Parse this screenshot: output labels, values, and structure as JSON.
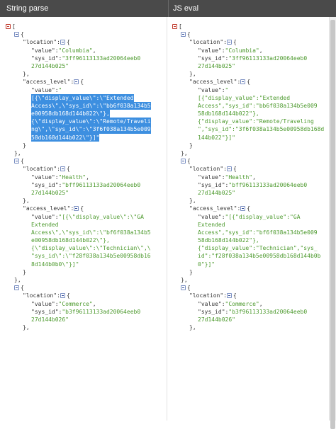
{
  "headers": {
    "left": "String parse",
    "right": "JS eval"
  },
  "left_lines": [
    {
      "i": 0,
      "t": "red",
      "parts": [
        [
          "p",
          "["
        ]
      ]
    },
    {
      "i": 2,
      "t": "blue",
      "parts": [
        [
          "p",
          "{"
        ]
      ]
    },
    {
      "i": 4,
      "parts": [
        [
          "k",
          "\"location\""
        ],
        [
          "p",
          ":"
        ]
      ],
      "t2": "blue",
      "after": [
        [
          "p",
          "{"
        ]
      ]
    },
    {
      "i": 6,
      "parts": [
        [
          "k",
          "\"value\""
        ],
        [
          "p",
          ":"
        ],
        [
          "s",
          "\"Columbia\""
        ],
        [
          "p",
          ","
        ]
      ]
    },
    {
      "i": 6,
      "parts": [
        [
          "k",
          "\"sys_id\""
        ],
        [
          "p",
          ":"
        ],
        [
          "s",
          "\"3ff96113133ad20064eeb0"
        ]
      ]
    },
    {
      "i": 6,
      "parts": [
        [
          "s",
          "27d144b025\""
        ]
      ]
    },
    {
      "i": 4,
      "parts": [
        [
          "p",
          "},"
        ]
      ]
    },
    {
      "i": 4,
      "parts": [
        [
          "k",
          "\"access_level\""
        ],
        [
          "p",
          ":"
        ]
      ],
      "t2": "blue",
      "after": [
        [
          "p",
          "{"
        ]
      ]
    },
    {
      "i": 6,
      "parts": [
        [
          "k",
          "\"value\""
        ],
        [
          "p",
          ":"
        ],
        [
          "s",
          "\""
        ]
      ]
    },
    {
      "i": 6,
      "sel": true,
      "parts": [
        [
          "x",
          "[{\\\"display_value\\\":\\\"Extended"
        ]
      ]
    },
    {
      "i": 6,
      "sel": true,
      "parts": [
        [
          "x",
          "Access\\\",\\\"sys_id\\\":\\\"bb6f038a134b5"
        ]
      ]
    },
    {
      "i": 6,
      "sel": true,
      "parts": [
        [
          "x",
          "e00958db168d144b022\\\"},"
        ]
      ]
    },
    {
      "i": 6,
      "sel": true,
      "parts": [
        [
          "x",
          "{\\\"display_value\\\":\\\"Remote/Traveli"
        ]
      ]
    },
    {
      "i": 6,
      "sel": true,
      "parts": [
        [
          "x",
          "ng\\\",\\\"sys_id\\\":\\\"3f6f038a134b5e009"
        ]
      ]
    },
    {
      "i": 6,
      "sel": true,
      "parts": [
        [
          "x",
          "58db168d144b022\\\"}]\""
        ]
      ]
    },
    {
      "i": 4,
      "parts": [
        [
          "p",
          "}"
        ]
      ]
    },
    {
      "i": 2,
      "parts": [
        [
          "p",
          "},"
        ]
      ]
    },
    {
      "i": 2,
      "t": "blue",
      "parts": [
        [
          "p",
          "{"
        ]
      ]
    },
    {
      "i": 4,
      "parts": [
        [
          "k",
          "\"location\""
        ],
        [
          "p",
          ":"
        ]
      ],
      "t2": "blue",
      "after": [
        [
          "p",
          "{"
        ]
      ]
    },
    {
      "i": 6,
      "parts": [
        [
          "k",
          "\"value\""
        ],
        [
          "p",
          ":"
        ],
        [
          "s",
          "\"Health\""
        ],
        [
          "p",
          ","
        ]
      ]
    },
    {
      "i": 6,
      "parts": [
        [
          "k",
          "\"sys_id\""
        ],
        [
          "p",
          ":"
        ],
        [
          "s",
          "\"bff96113133ad20064eeb0"
        ]
      ]
    },
    {
      "i": 6,
      "parts": [
        [
          "s",
          "27d144b025\""
        ]
      ]
    },
    {
      "i": 4,
      "parts": [
        [
          "p",
          "},"
        ]
      ]
    },
    {
      "i": 4,
      "parts": [
        [
          "k",
          "\"access_level\""
        ],
        [
          "p",
          ":"
        ]
      ],
      "t2": "blue",
      "after": [
        [
          "p",
          "{"
        ]
      ]
    },
    {
      "i": 6,
      "parts": [
        [
          "k",
          "\"value\""
        ],
        [
          "p",
          ":"
        ],
        [
          "s",
          "\"[{\\\"display_value\\\":\\\"GA"
        ]
      ]
    },
    {
      "i": 6,
      "parts": [
        [
          "s",
          "Extended"
        ]
      ]
    },
    {
      "i": 6,
      "parts": [
        [
          "s",
          "Access\\\",\\\"sys_id\\\":\\\"bf6f038a134b5"
        ]
      ]
    },
    {
      "i": 6,
      "parts": [
        [
          "s",
          "e00958db168d144b022\\\"},"
        ]
      ]
    },
    {
      "i": 6,
      "parts": [
        [
          "s",
          "{\\\"display_value\\\":\\\"Technician\\\",\\"
        ]
      ]
    },
    {
      "i": 6,
      "parts": [
        [
          "s",
          "\"sys_id\\\":\\\"f28f038a134b5e00958db16"
        ]
      ]
    },
    {
      "i": 6,
      "parts": [
        [
          "s",
          "8d144b0b0\\\"}]\""
        ]
      ]
    },
    {
      "i": 4,
      "parts": [
        [
          "p",
          "}"
        ]
      ]
    },
    {
      "i": 2,
      "parts": [
        [
          "p",
          "},"
        ]
      ]
    },
    {
      "i": 2,
      "t": "blue",
      "parts": [
        [
          "p",
          "{"
        ]
      ]
    },
    {
      "i": 4,
      "parts": [
        [
          "k",
          "\"location\""
        ],
        [
          "p",
          ":"
        ]
      ],
      "t2": "blue",
      "after": [
        [
          "p",
          "{"
        ]
      ]
    },
    {
      "i": 6,
      "parts": [
        [
          "k",
          "\"value\""
        ],
        [
          "p",
          ":"
        ],
        [
          "s",
          "\"Commerce\""
        ],
        [
          "p",
          ","
        ]
      ]
    },
    {
      "i": 6,
      "parts": [
        [
          "k",
          "\"sys_id\""
        ],
        [
          "p",
          ":"
        ],
        [
          "s",
          "\"b3f96113133ad20064eeb0"
        ]
      ]
    },
    {
      "i": 6,
      "parts": [
        [
          "s",
          "27d144b026\""
        ]
      ]
    },
    {
      "i": 4,
      "parts": [
        [
          "p",
          "},"
        ]
      ]
    }
  ],
  "right_lines": [
    {
      "i": 0,
      "t": "red",
      "parts": [
        [
          "p",
          "["
        ]
      ]
    },
    {
      "i": 2,
      "t": "blue",
      "parts": [
        [
          "p",
          "{"
        ]
      ]
    },
    {
      "i": 4,
      "parts": [
        [
          "k",
          "\"location\""
        ],
        [
          "p",
          ":"
        ]
      ],
      "t2": "blue",
      "after": [
        [
          "p",
          "{"
        ]
      ]
    },
    {
      "i": 6,
      "parts": [
        [
          "k",
          "\"value\""
        ],
        [
          "p",
          ":"
        ],
        [
          "s",
          "\"Columbia\""
        ],
        [
          "p",
          ","
        ]
      ]
    },
    {
      "i": 6,
      "parts": [
        [
          "k",
          "\"sys_id\""
        ],
        [
          "p",
          ":"
        ],
        [
          "s",
          "\"3ff96113133ad20064eeb0"
        ]
      ]
    },
    {
      "i": 6,
      "parts": [
        [
          "s",
          "27d144b025\""
        ]
      ]
    },
    {
      "i": 4,
      "parts": [
        [
          "p",
          "},"
        ]
      ]
    },
    {
      "i": 4,
      "parts": [
        [
          "k",
          "\"access_level\""
        ],
        [
          "p",
          ":"
        ]
      ],
      "t2": "blue",
      "after": [
        [
          "p",
          "{"
        ]
      ]
    },
    {
      "i": 6,
      "parts": [
        [
          "k",
          "\"value\""
        ],
        [
          "p",
          ":"
        ],
        [
          "s",
          "\""
        ]
      ]
    },
    {
      "i": 6,
      "parts": [
        [
          "s",
          "[{\"display_value\":\"Extended"
        ]
      ]
    },
    {
      "i": 6,
      "parts": [
        [
          "s",
          "Access\",\"sys_id\":\"bb6f038a134b5e009"
        ]
      ]
    },
    {
      "i": 6,
      "parts": [
        [
          "s",
          "58db168d144b022\"},"
        ]
      ]
    },
    {
      "i": 6,
      "parts": [
        [
          "s",
          "{\"display_value\":\"Remote/Traveling"
        ]
      ]
    },
    {
      "i": 6,
      "parts": [
        [
          "s",
          "\",\"sys_id\":\"3f6f038a134b5e00958db168d"
        ]
      ]
    },
    {
      "i": 6,
      "parts": [
        [
          "s",
          "144b022\"}]\""
        ]
      ]
    },
    {
      "i": 4,
      "parts": [
        [
          "p",
          "}"
        ]
      ]
    },
    {
      "i": 2,
      "parts": [
        [
          "p",
          "},"
        ]
      ]
    },
    {
      "i": 2,
      "t": "blue",
      "parts": [
        [
          "p",
          "{"
        ]
      ]
    },
    {
      "i": 4,
      "parts": [
        [
          "k",
          "\"location\""
        ],
        [
          "p",
          ":"
        ]
      ],
      "t2": "blue",
      "after": [
        [
          "p",
          "{"
        ]
      ]
    },
    {
      "i": 6,
      "parts": [
        [
          "k",
          "\"value\""
        ],
        [
          "p",
          ":"
        ],
        [
          "s",
          "\"Health\""
        ],
        [
          "p",
          ","
        ]
      ]
    },
    {
      "i": 6,
      "parts": [
        [
          "k",
          "\"sys_id\""
        ],
        [
          "p",
          ":"
        ],
        [
          "s",
          "\"bff96113133ad20064eeb0"
        ]
      ]
    },
    {
      "i": 6,
      "parts": [
        [
          "s",
          "27d144b025\""
        ]
      ]
    },
    {
      "i": 4,
      "parts": [
        [
          "p",
          "},"
        ]
      ]
    },
    {
      "i": 4,
      "parts": [
        [
          "k",
          "\"access_level\""
        ],
        [
          "p",
          ":"
        ]
      ],
      "t2": "blue",
      "after": [
        [
          "p",
          "{"
        ]
      ]
    },
    {
      "i": 6,
      "parts": [
        [
          "k",
          "\"value\""
        ],
        [
          "p",
          ":"
        ],
        [
          "s",
          "\"[{\"display_value\":\"GA"
        ]
      ]
    },
    {
      "i": 6,
      "parts": [
        [
          "s",
          "Extended"
        ]
      ]
    },
    {
      "i": 6,
      "parts": [
        [
          "s",
          "Access\",\"sys_id\":\"bf6f038a134b5e009"
        ]
      ]
    },
    {
      "i": 6,
      "parts": [
        [
          "s",
          "58db168d144b022\"},"
        ]
      ]
    },
    {
      "i": 6,
      "parts": [
        [
          "s",
          "{\"display_value\":\"Technician\",\"sys_"
        ]
      ]
    },
    {
      "i": 6,
      "parts": [
        [
          "s",
          "id\":\"f28f038a134b5e00958db168d144b0b"
        ]
      ]
    },
    {
      "i": 6,
      "parts": [
        [
          "s",
          "0\"}]\""
        ]
      ]
    },
    {
      "i": 4,
      "parts": [
        [
          "p",
          "}"
        ]
      ]
    },
    {
      "i": 2,
      "parts": [
        [
          "p",
          "},"
        ]
      ]
    },
    {
      "i": 2,
      "t": "blue",
      "parts": [
        [
          "p",
          "{"
        ]
      ]
    },
    {
      "i": 4,
      "parts": [
        [
          "k",
          "\"location\""
        ],
        [
          "p",
          ":"
        ]
      ],
      "t2": "blue",
      "after": [
        [
          "p",
          "{"
        ]
      ]
    },
    {
      "i": 6,
      "parts": [
        [
          "k",
          "\"value\""
        ],
        [
          "p",
          ":"
        ],
        [
          "s",
          "\"Commerce\""
        ],
        [
          "p",
          ","
        ]
      ]
    },
    {
      "i": 6,
      "parts": [
        [
          "k",
          "\"sys_id\""
        ],
        [
          "p",
          ":"
        ],
        [
          "s",
          "\"b3f96113133ad20064eeb0"
        ]
      ]
    },
    {
      "i": 6,
      "parts": [
        [
          "s",
          "27d144b026\""
        ]
      ]
    },
    {
      "i": 4,
      "parts": [
        [
          "p",
          "},"
        ]
      ]
    }
  ],
  "colors": {
    "header_bg": "#4a4a4a",
    "string": "#4d9a2e",
    "selection": "#3d8fe0",
    "toggle_blue": "#3b55a0",
    "toggle_red": "#c0392b"
  }
}
